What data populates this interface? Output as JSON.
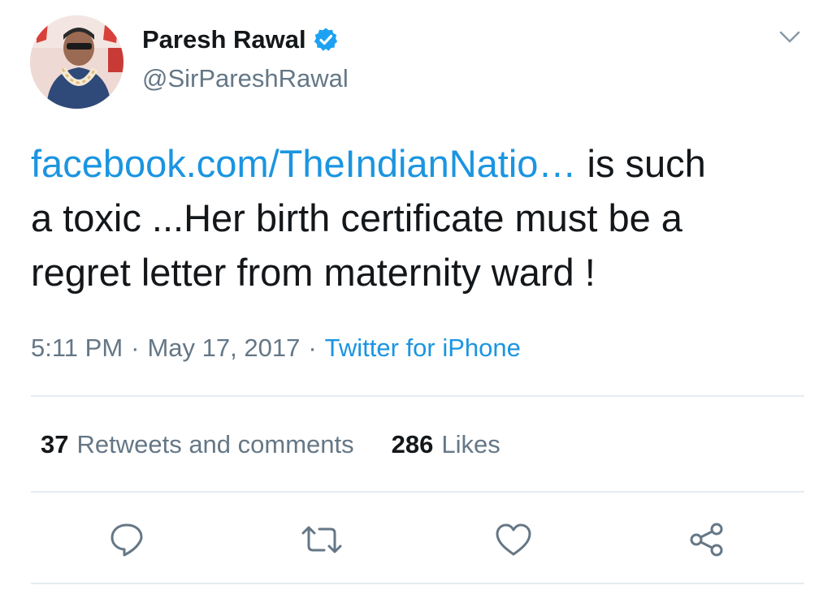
{
  "user": {
    "display_name": "Paresh Rawal",
    "handle": "@SirPareshRawal",
    "verified": true
  },
  "tweet": {
    "link_text": "facebook.com/TheIndianNatio…",
    "text_line1_rest": " is such",
    "text_line2": "a toxic ...Her birth certificate must be a",
    "text_line3": "regret letter from maternity ward  !"
  },
  "meta": {
    "time": "5:11 PM",
    "date": "May 17, 2017",
    "separator": "·",
    "source": "Twitter for iPhone"
  },
  "stats": {
    "retweets_count": "37",
    "retweets_label": "Retweets and comments",
    "likes_count": "286",
    "likes_label": "Likes"
  },
  "icons": {
    "reply": "comment-bubble-icon",
    "retweet": "retweet-icon",
    "like": "heart-icon",
    "share": "share-icon",
    "caret": "chevron-down-icon",
    "verified": "verified-badge-icon"
  },
  "colors": {
    "link": "#1b95e0",
    "secondary_text": "#657786",
    "primary_text": "#14171a",
    "divider": "#e6ecf0",
    "verified_badge": "#1da1f2"
  }
}
